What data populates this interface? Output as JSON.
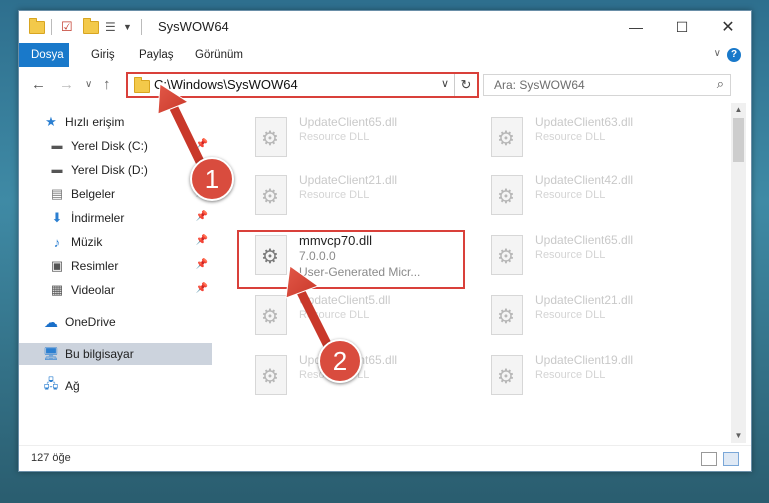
{
  "window": {
    "title": "SysWOW64"
  },
  "ribbon": {
    "tabs": [
      {
        "label": "Dosya"
      },
      {
        "label": "Giriş"
      },
      {
        "label": "Paylaş"
      },
      {
        "label": "Görünüm"
      }
    ],
    "help": "?"
  },
  "address": {
    "path": "C:\\Windows\\SysWOW64",
    "search_placeholder": "Ara: SysWOW64"
  },
  "nav": {
    "items": [
      {
        "label": "Hızlı erişim",
        "icon": "star-icon"
      },
      {
        "label": "Yerel Disk (C:)",
        "icon": "drive-icon"
      },
      {
        "label": "Yerel Disk (D:)",
        "icon": "drive-icon"
      },
      {
        "label": "Belgeler",
        "icon": "documents-icon"
      },
      {
        "label": "İndirmeler",
        "icon": "download-icon"
      },
      {
        "label": "Müzik",
        "icon": "music-icon"
      },
      {
        "label": "Resimler",
        "icon": "pictures-icon"
      },
      {
        "label": "Videolar",
        "icon": "videos-icon"
      },
      {
        "label": "OneDrive",
        "icon": "cloud-icon"
      },
      {
        "label": "Bu bilgisayar",
        "icon": "computer-icon"
      },
      {
        "label": "Ağ",
        "icon": "network-icon"
      }
    ]
  },
  "files": [
    {
      "name": "UpdateClient65.dll",
      "sub": "Resource DLL"
    },
    {
      "name": "UpdateClient63.dll",
      "sub": "Resource DLL"
    },
    {
      "name": "UpdateClient21.dll",
      "sub": "Resource DLL"
    },
    {
      "name": "UpdateClient42.dll",
      "sub": "Resource DLL"
    },
    {
      "name": "mmvcp70.dll",
      "sub": "7.0.0.0",
      "sub2": "User-Generated Micr..."
    },
    {
      "name": "UpdateClient65.dll",
      "sub": "Resource DLL"
    },
    {
      "name": "UpdateClient5.dll",
      "sub": "Resource DLL"
    },
    {
      "name": "UpdateClient21.dll",
      "sub": "Resource DLL"
    },
    {
      "name": "UpdateClient65.dll",
      "sub": "Resource DLL"
    },
    {
      "name": "UpdateClient19.dll",
      "sub": "Resource DLL"
    }
  ],
  "status": {
    "count": "127 öğe"
  },
  "annotations": {
    "step1": "1",
    "step2": "2"
  },
  "colors": {
    "accent": "#1979ca",
    "highlight_red": "#d9403a",
    "badge_red": "#d94c3e"
  }
}
